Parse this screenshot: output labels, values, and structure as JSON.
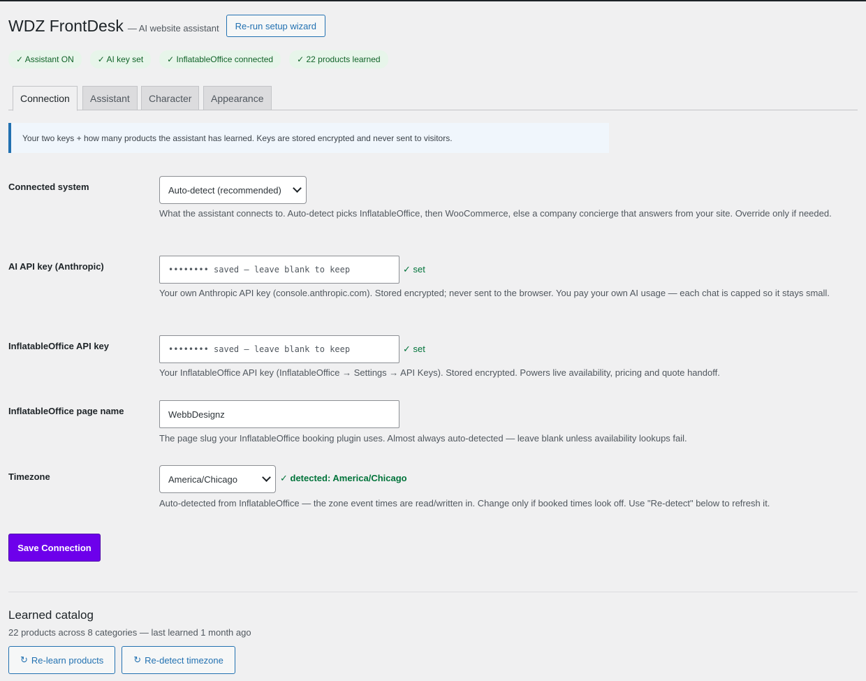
{
  "header": {
    "title": "WDZ FrontDesk",
    "subtitle": "— AI website assistant",
    "rerun_label": "Re-run setup wizard"
  },
  "badges": [
    "✓ Assistant ON",
    "✓ AI key set",
    "✓ InflatableOffice connected",
    "✓ 22 products learned"
  ],
  "tabs": [
    "Connection",
    "Assistant",
    "Character",
    "Appearance"
  ],
  "notice": "Your two keys + how many products the assistant has learned. Keys are stored encrypted and never sent to visitors.",
  "fields": {
    "system": {
      "label": "Connected system",
      "value": "Auto-detect (recommended)",
      "desc": "What the assistant connects to. Auto-detect picks InflatableOffice, then WooCommerce, else a company concierge that answers from your site. Override only if needed."
    },
    "ai_key": {
      "label": "AI API key (Anthropic)",
      "placeholder": "•••••••• saved — leave blank to keep",
      "status": "✓ set",
      "desc": "Your own Anthropic API key (console.anthropic.com). Stored encrypted; never sent to the browser. You pay your own AI usage — each chat is capped so it stays small."
    },
    "io_key": {
      "label": "InflatableOffice API key",
      "placeholder": "•••••••• saved — leave blank to keep",
      "status": "✓ set",
      "desc": "Your InflatableOffice API key (InflatableOffice → Settings → API Keys). Stored encrypted. Powers live availability, pricing and quote handoff."
    },
    "page_name": {
      "label": "InflatableOffice page name",
      "value": "WebbDesignz",
      "desc": "The page slug your InflatableOffice booking plugin uses. Almost always auto-detected — leave blank unless availability lookups fail."
    },
    "timezone": {
      "label": "Timezone",
      "value": "America/Chicago",
      "status": "✓ detected: America/Chicago",
      "desc": "Auto-detected from InflatableOffice — the zone event times are read/written in. Change only if booked times look off. Use \"Re-detect\" below to refresh it."
    }
  },
  "save_label": "Save Connection",
  "catalog": {
    "title": "Learned catalog",
    "summary": "22 products across 8 categories — last learned 1 month ago",
    "relearn_label": "Re-learn products",
    "redetect_label": "Re-detect timezone"
  },
  "colors": {
    "accent": "#2271b1",
    "primary_button": "#6d00eb",
    "success": "#00733a",
    "badge_bg": "#e7f5ea"
  },
  "icons": {
    "refresh": "↻"
  }
}
